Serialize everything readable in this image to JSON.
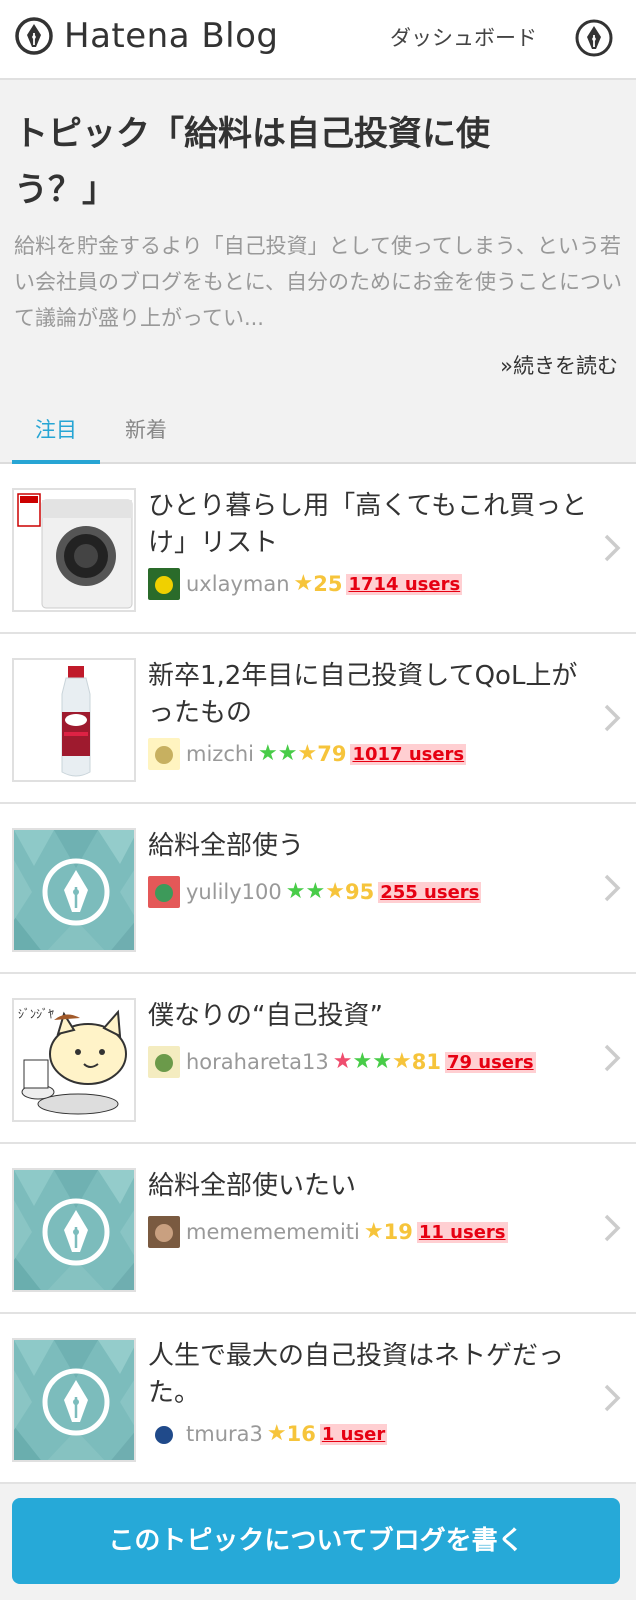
{
  "header": {
    "brand": "Hatena Blog",
    "dashboard_label": "ダッシュボード"
  },
  "topic": {
    "title": "トピック「給料は自己投資に使う？」",
    "description": "給料を貯金するより「自己投資」として使ってしまう、という若い会社員のブログをもとに、自分のためにお金を使うことについて議論が盛り上がってい...",
    "read_more": "»続きを読む"
  },
  "tabs": [
    {
      "label": "注目",
      "active": true
    },
    {
      "label": "新着",
      "active": false
    }
  ],
  "entries": [
    {
      "title": "ひとり暮らし用「高くてもこれ買っとけ」リスト",
      "user": "uxlayman",
      "star_colors": [
        "yellow"
      ],
      "star_count": "25",
      "users": "1714 users",
      "thumb": "washing-machine-image"
    },
    {
      "title": "新卒1,2年目に自己投資してQoL上がったもの",
      "user": "mizchi",
      "star_colors": [
        "green",
        "green",
        "yellow"
      ],
      "star_count": "79",
      "users": "1017 users",
      "thumb": "bottle-image"
    },
    {
      "title": "給料全部使う",
      "user": "yulily100",
      "star_colors": [
        "green",
        "green",
        "yellow"
      ],
      "star_count": "95",
      "users": "255 users",
      "thumb": "hatena-pen-image"
    },
    {
      "title": "僕なりの“自己投資”",
      "user": "horahareta13",
      "star_colors": [
        "red",
        "green",
        "green",
        "yellow"
      ],
      "star_count": "81",
      "users": "79 users",
      "thumb": "cat-illustration-image"
    },
    {
      "title": "給料全部使いたい",
      "user": "mememememiti",
      "star_colors": [
        "yellow"
      ],
      "star_count": "19",
      "users": "11 users",
      "thumb": "hatena-pen-image"
    },
    {
      "title": "人生で最大の自己投資はネトゲだった。",
      "user": "tmura3",
      "star_colors": [
        "yellow"
      ],
      "star_count": "16",
      "users": "1 user",
      "thumb": "hatena-pen-image"
    }
  ],
  "cta": {
    "label": "このトピックについてブログを書く"
  },
  "colors": {
    "accent": "#27a5d4",
    "button": "#26a9d8",
    "users_red": "#e60012",
    "star_yellow": "#f6c43b",
    "star_green": "#48cc48",
    "star_red": "#ef4d6e"
  }
}
